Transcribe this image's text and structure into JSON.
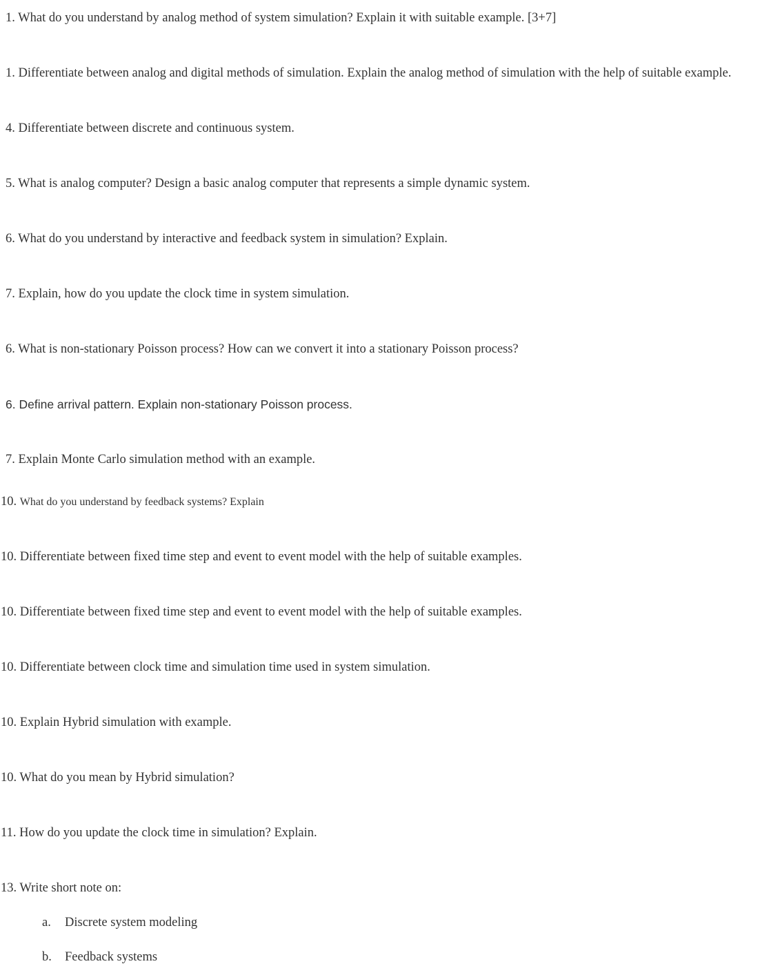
{
  "questions": [
    {
      "num": "1.",
      "text": "What do you understand by analog method of system simulation? Explain it with suitable example. [3+7]"
    },
    {
      "num": "1.",
      "text": "Differentiate between analog and digital methods of simulation. Explain the analog method of simulation with the help of suitable example."
    },
    {
      "num": "4.",
      "text": "Differentiate between discrete and continuous system."
    },
    {
      "num": "5.",
      "text": "What is analog computer? Design a basic analog computer that represents a simple dynamic system."
    },
    {
      "num": "6.",
      "text": "What do you understand by interactive and feedback system in simulation? Explain."
    },
    {
      "num": "7.",
      "text": "Explain, how do you update the clock time in system simulation."
    },
    {
      "num": "6.",
      "text": "What is non-stationary Poisson process? How can we convert it into a stationary Poisson process?"
    },
    {
      "num": "6.",
      "text": "Define arrival pattern. Explain non-stationary Poisson process."
    },
    {
      "num": "7.",
      "text": "Explain Monte Carlo simulation method with an example."
    },
    {
      "num": "10.",
      "text": "What do you understand by feedback systems? Explain"
    },
    {
      "num": "10.",
      "text": "Differentiate between fixed time step and event to event model with the help of suitable examples."
    },
    {
      "num": "10.",
      "text": "Differentiate between fixed time step and event to event model with the help of suitable examples."
    },
    {
      "num": "10.",
      "text": "Differentiate between clock time and simulation time used in system simulation."
    },
    {
      "num": "10.",
      "text": "Explain Hybrid simulation with example."
    },
    {
      "num": "10.",
      "text": "What do you mean by Hybrid simulation?"
    },
    {
      "num": "11.",
      "text": "How do you update the clock time in simulation? Explain."
    },
    {
      "num": "13.",
      "text": "Write short note on:"
    }
  ],
  "subitems": [
    {
      "letter": "a.",
      "text": "Discrete system modeling"
    },
    {
      "letter": "b.",
      "text": "Feedback systems"
    }
  ]
}
